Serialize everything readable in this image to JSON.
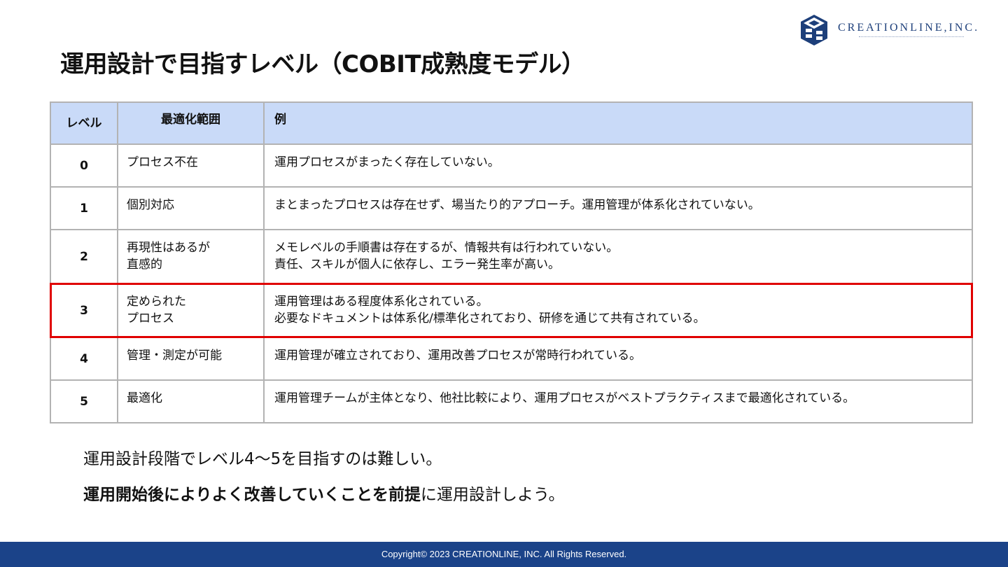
{
  "logo": {
    "name": "CREATIONLINE,INC."
  },
  "title": "運用設計で目指すレベル（COBIT成熟度モデル）",
  "table": {
    "headers": {
      "level": "レベル",
      "scope": "最適化範囲",
      "example": "例"
    },
    "rows": [
      {
        "level": "0",
        "scope": "プロセス不在",
        "example": "運用プロセスがまったく存在していない。"
      },
      {
        "level": "1",
        "scope": "個別対応",
        "example": "まとまったプロセスは存在せず、場当たり的アプローチ。運用管理が体系化されていない。"
      },
      {
        "level": "2",
        "scope": "再現性はあるが\n直感的",
        "example": "メモレベルの手順書は存在するが、情報共有は行われていない。\n責任、スキルが個人に依存し、エラー発生率が高い。"
      },
      {
        "level": "3",
        "scope": "定められた\nプロセス",
        "example": "運用管理はある程度体系化されている。\n必要なドキュメントは体系化/標準化されており、研修を通じて共有されている。",
        "highlighted": true
      },
      {
        "level": "4",
        "scope": "管理・測定が可能",
        "example": "運用管理が確立されており、運用改善プロセスが常時行われている。"
      },
      {
        "level": "5",
        "scope": "最適化",
        "example": "運用管理チームが主体となり、他社比較により、運用プロセスがベストプラクティスまで最適化されている。"
      }
    ]
  },
  "notes": {
    "line1": "運用設計段階でレベル4～5を目指すのは難しい。",
    "line2_bold": "運用開始後によりよく改善していくことを前提",
    "line2_rest": "に運用設計しよう。"
  },
  "footer": {
    "copyright": "Copyright© 2023 CREATIONLINE, INC. All Rights Reserved."
  },
  "colors": {
    "header_fill": "#c9daf8",
    "highlight_border": "#e00000",
    "footer_bar": "#1b4389",
    "brand": "#1d3f7a"
  }
}
